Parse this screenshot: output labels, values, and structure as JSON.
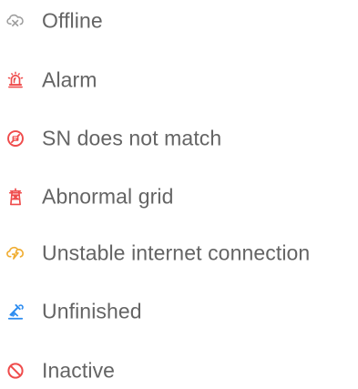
{
  "legend": {
    "items": [
      {
        "label": "Offline",
        "icon": "offline-icon",
        "color": "#9e9e9e"
      },
      {
        "label": "Alarm",
        "icon": "alarm-icon",
        "color": "#ef4b4b"
      },
      {
        "label": "SN does not match",
        "icon": "sn-mismatch-icon",
        "color": "#ef4b4b"
      },
      {
        "label": "Abnormal grid",
        "icon": "abnormal-grid-icon",
        "color": "#ef4b4b"
      },
      {
        "label": "Unstable internet connection",
        "icon": "unstable-connection-icon",
        "color": "#f0ad32"
      },
      {
        "label": "Unfinished",
        "icon": "unfinished-icon",
        "color": "#2d8cf0"
      },
      {
        "label": "Inactive",
        "icon": "inactive-icon",
        "color": "#ef4b4b"
      }
    ]
  }
}
